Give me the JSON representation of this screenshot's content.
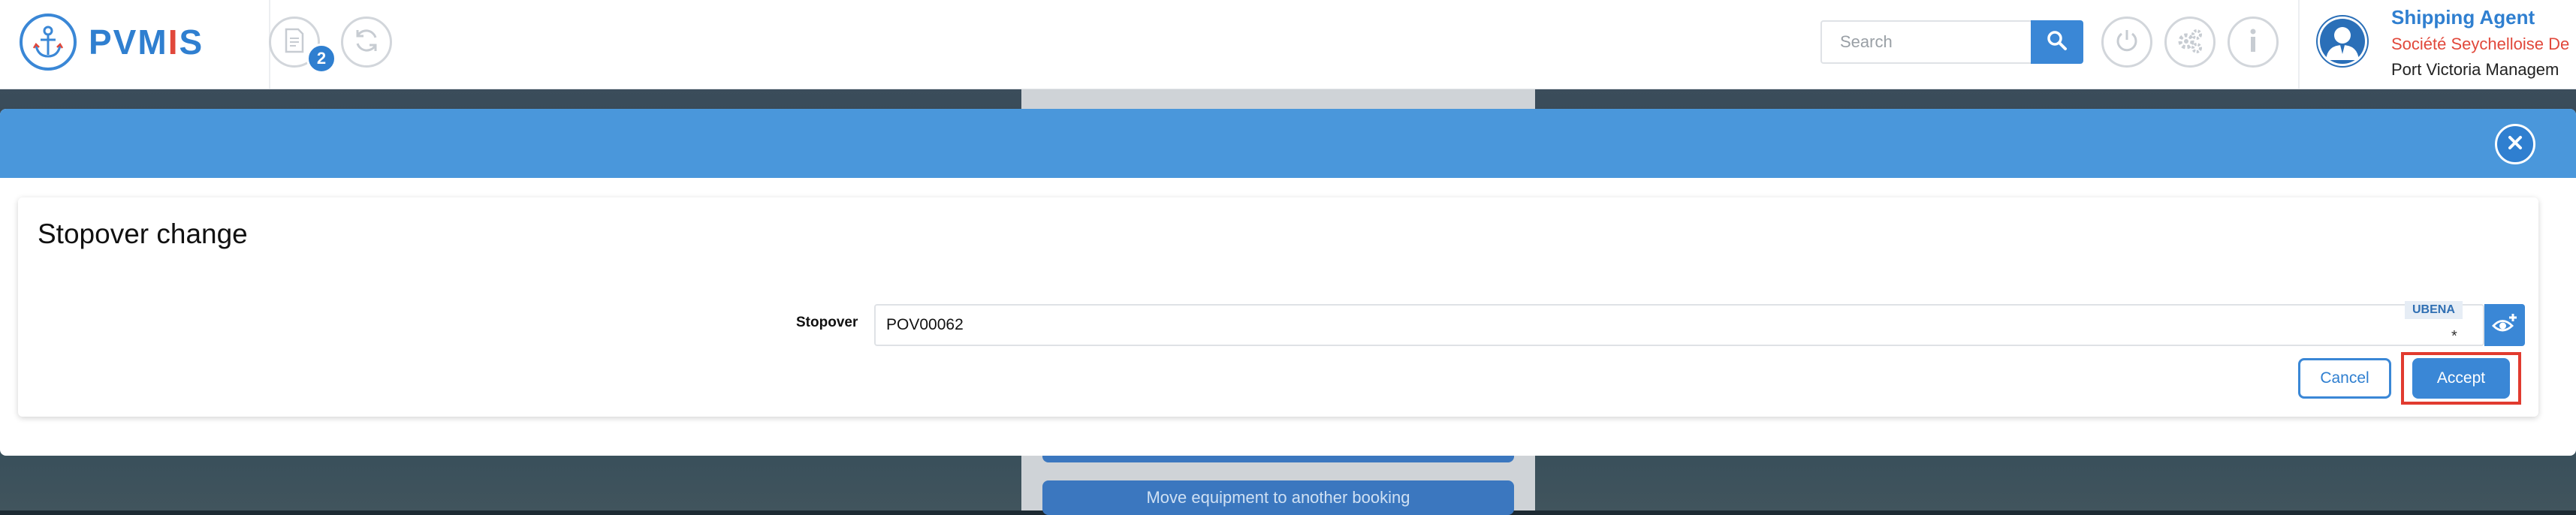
{
  "app": {
    "logo_text_a": "PVM",
    "logo_text_i": "I",
    "logo_text_b": "S"
  },
  "header": {
    "notification_count": "2",
    "search": {
      "placeholder": "Search",
      "value": ""
    },
    "user": {
      "role": "Shipping Agent",
      "company": "Société Seychelloise De",
      "organization": "Port Victoria Managem"
    }
  },
  "background": {
    "button_move_equipment": "Move equipment to another booking"
  },
  "modal": {
    "title": "Stopover change",
    "stopover_label": "Stopover",
    "stopover_value": "POV00062",
    "stopover_tag": "UBENA",
    "required_mark": "*",
    "cancel_label": "Cancel",
    "accept_label": "Accept"
  },
  "colors": {
    "primary": "#3a87d6",
    "header_blue": "#4a97db",
    "accent_red": "#e1483b"
  },
  "icons": [
    "anchor-icon",
    "document-icon",
    "refresh-icon",
    "search-icon",
    "power-icon",
    "settings-icon",
    "info-icon",
    "user-icon",
    "close-icon",
    "eye-plus-icon"
  ]
}
